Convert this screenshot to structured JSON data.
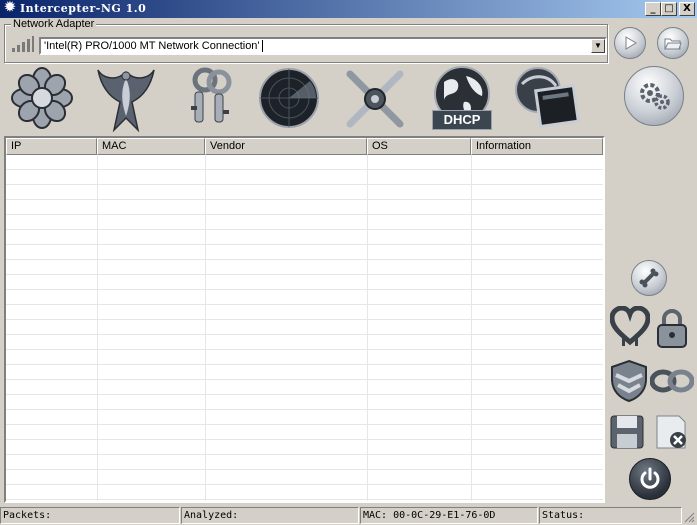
{
  "window": {
    "title": "Intercepter-NG 1.0",
    "controls": {
      "minimize": "_",
      "maximize": "□",
      "close": "X"
    }
  },
  "adapter": {
    "group_label": "Network Adapter",
    "selected": "'Intel(R) PRO/1000 MT Network Connection'"
  },
  "top_buttons": [
    "play-icon",
    "folder-icon"
  ],
  "toolbar": [
    "flower-icon",
    "phoenix-icon",
    "keys-icon",
    "radar-icon",
    "crossed-swords-icon",
    "dhcp-globe-icon",
    "network-terminal-icon"
  ],
  "dhcp_label": "DHCP",
  "table": {
    "columns": [
      "IP",
      "MAC",
      "Vendor",
      "OS",
      "Information"
    ],
    "rows": []
  },
  "side_buttons": [
    "settings-gears-icon",
    "bone-icon",
    "heartbleed-icon",
    "padlock-icon",
    "shield-icon",
    "chain-icon",
    "save-disk-icon",
    "clear-list-icon",
    "power-icon"
  ],
  "status": {
    "packets": "Packets:",
    "analyzed": "Analyzed:",
    "mac": "MAC: 00-0C-29-E1-76-0D",
    "status": "Status:"
  },
  "colors": {
    "window_bg": "#d4d0c8",
    "titlebar_start": "#0a246a",
    "titlebar_end": "#a6caf0",
    "dhcp_label_bg": "#3c4650"
  }
}
